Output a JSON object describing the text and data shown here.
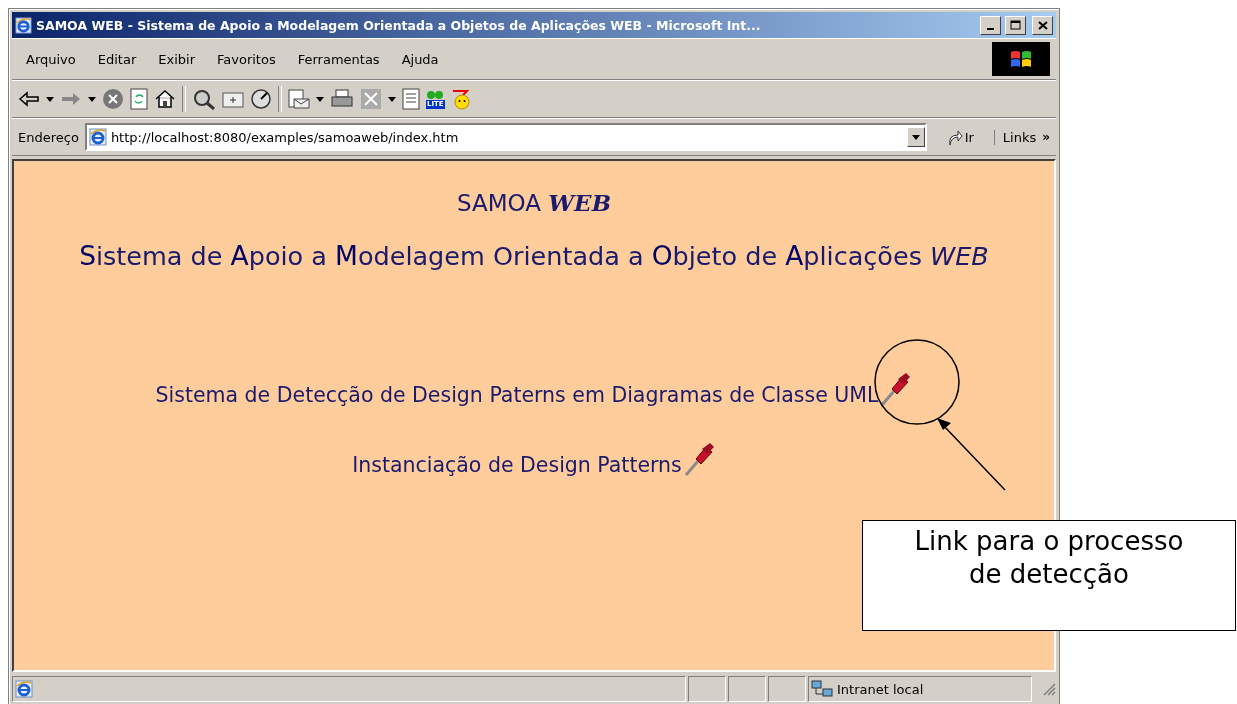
{
  "window": {
    "title": "SAMOA WEB - Sistema de Apoio a Modelagem Orientada a Objetos de Aplicações WEB - Microsoft Int..."
  },
  "menu": [
    "Arquivo",
    "Editar",
    "Exibir",
    "Favoritos",
    "Ferramentas",
    "Ajuda"
  ],
  "toolbar": {
    "badge": "LITE"
  },
  "address_bar": {
    "label": "Endereço",
    "value": "http://localhost:8080/examples/samoaweb/index.htm",
    "go": "Ir",
    "links": "Links",
    "more": "»"
  },
  "page": {
    "heading": {
      "text": "SAMOA",
      "emphasis": "WEB"
    },
    "subtitle": "**S**istema de **A**poio a **M**odelagem Orientada a **O**bjeto de **A**plicações *WEB*",
    "links": [
      {
        "text": "Sistema de Detecção de Design Paterns em Diagramas de Classe UML",
        "highlighted": true
      },
      {
        "text": "Instanciação de Design Patterns",
        "highlighted": false
      }
    ]
  },
  "status_bar": {
    "zone": "Intranet local"
  },
  "callout": {
    "text": "Link para o processo de detecção"
  }
}
